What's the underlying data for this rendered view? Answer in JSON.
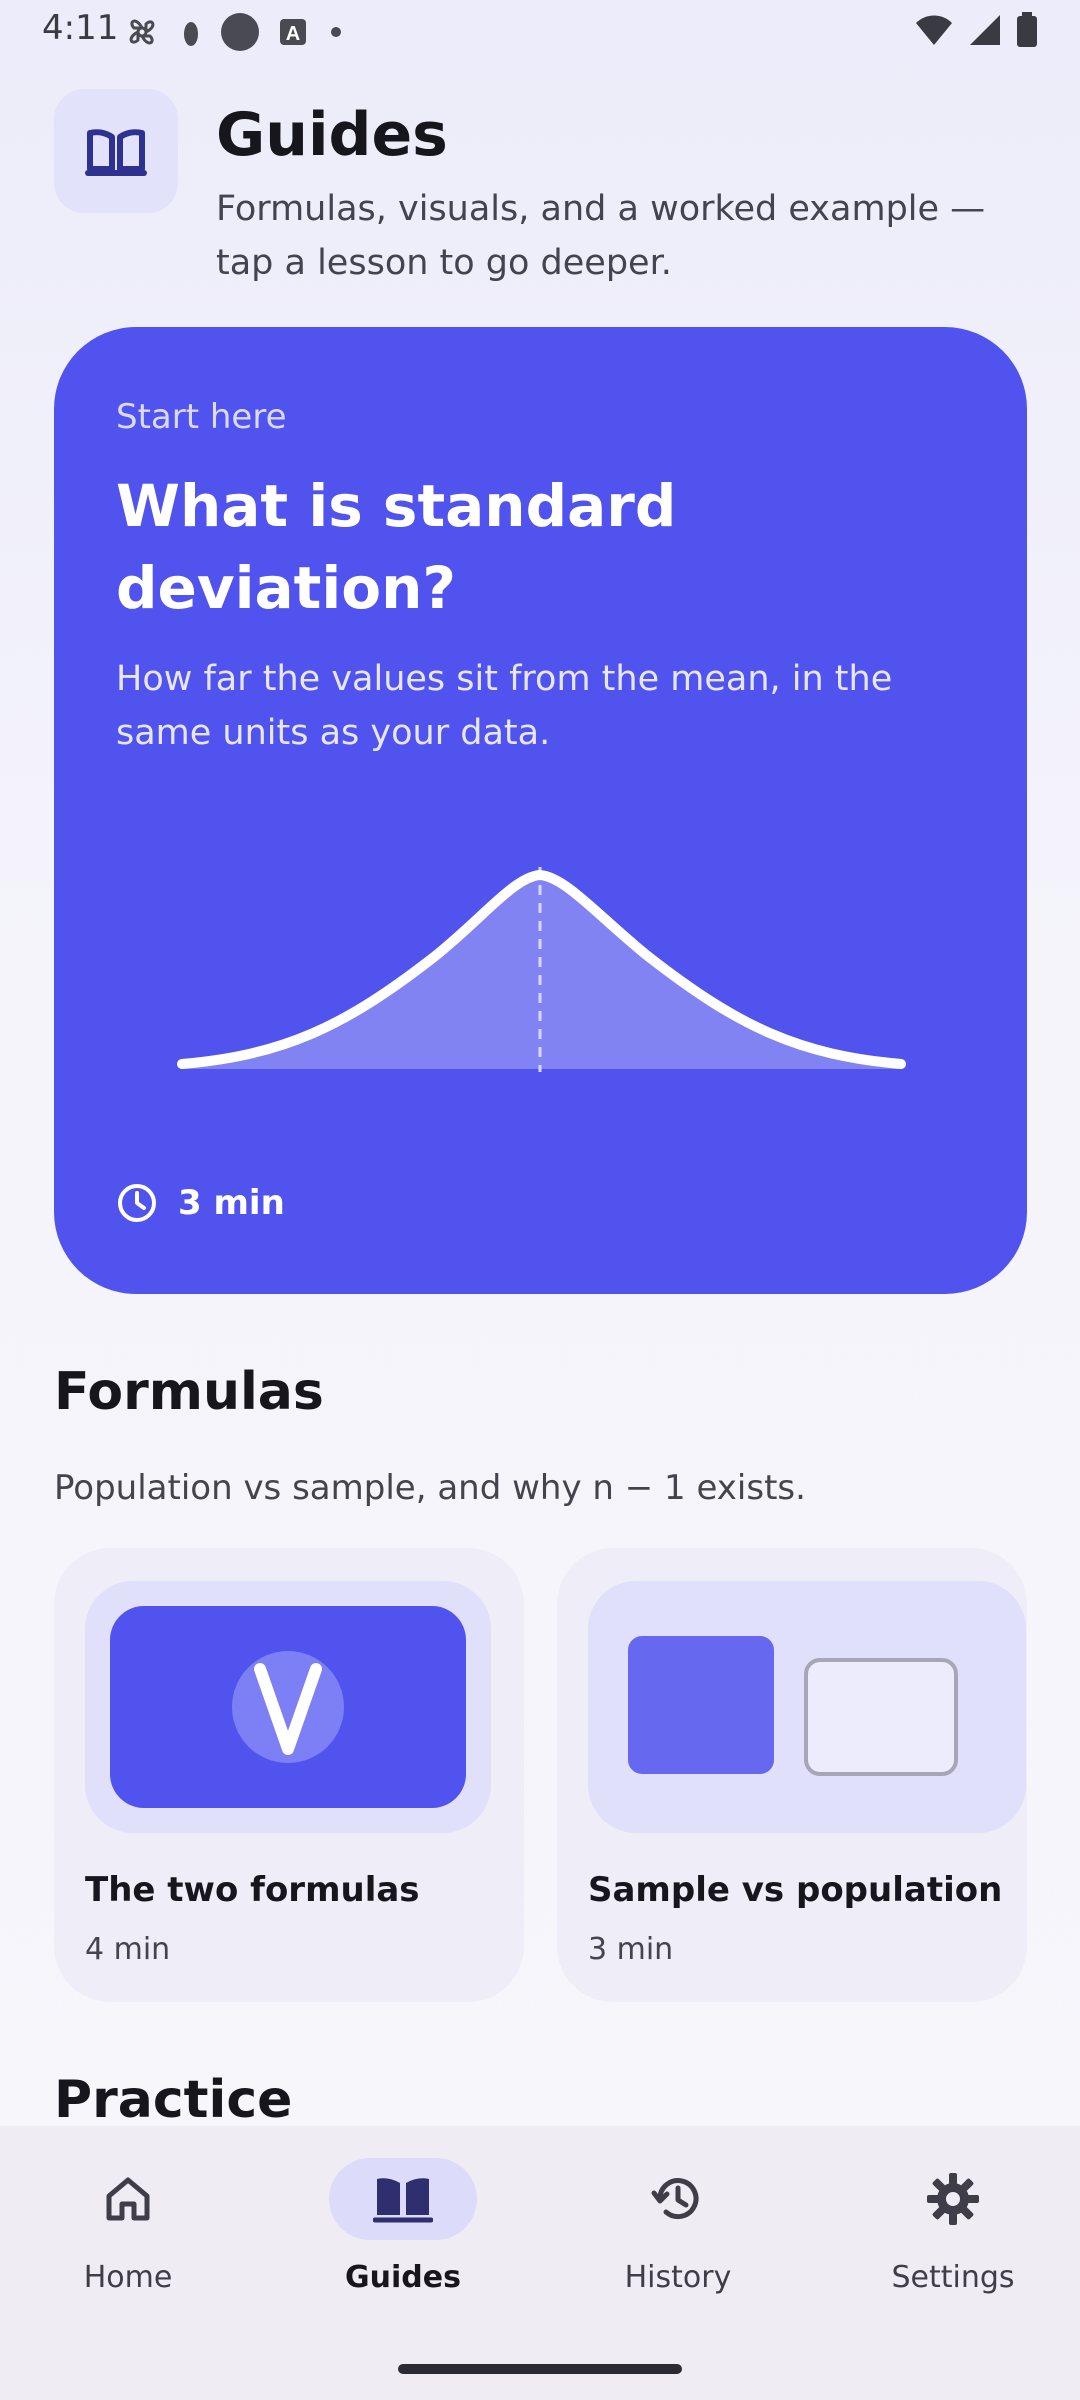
{
  "status_bar": {
    "time": "4:11"
  },
  "header": {
    "title": "Guides",
    "subtitle": "Formulas, visuals, and a worked example — tap a lesson to go deeper.",
    "icon": "open-book-icon"
  },
  "hero": {
    "eyebrow": "Start here",
    "title": "What is standard deviation?",
    "description": "How far the values sit from the mean, in the same units as your data.",
    "duration": "3 min",
    "illustration": "bell-curve-with-mean-line",
    "colors": {
      "background": "#5053ee",
      "text": "#ffffff"
    }
  },
  "formulas": {
    "title": "Formulas",
    "subtitle": "Population vs sample, and why n − 1 exists.",
    "lessons": [
      {
        "title": "The two formulas",
        "duration": "4 min",
        "illustration": "check-mark-icon"
      },
      {
        "title": "Sample vs population",
        "duration": "3 min",
        "illustration": "compare-boxes"
      }
    ]
  },
  "practice": {
    "title": "Practice"
  },
  "bottom_nav": {
    "active": "Guides",
    "items": [
      {
        "label": "Home",
        "icon": "home-icon"
      },
      {
        "label": "Guides",
        "icon": "open-book-icon"
      },
      {
        "label": "History",
        "icon": "history-icon"
      },
      {
        "label": "Settings",
        "icon": "gear-icon"
      }
    ]
  },
  "colors": {
    "accent": "#5053ee",
    "accent_light": "#e1e0fb"
  }
}
